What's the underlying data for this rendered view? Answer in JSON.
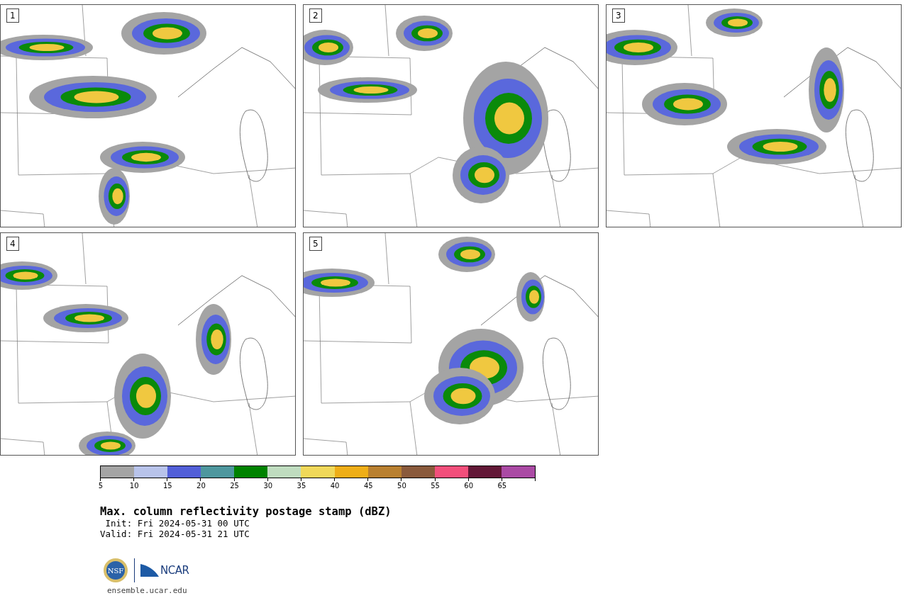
{
  "panels": [
    {
      "label": "1"
    },
    {
      "label": "2"
    },
    {
      "label": "3"
    },
    {
      "label": "4"
    },
    {
      "label": "5"
    }
  ],
  "colorbar": {
    "segments": [
      {
        "color": "#a4a4a4",
        "label": "5"
      },
      {
        "color": "#b8c3ea",
        "label": "10"
      },
      {
        "color": "#525fd8",
        "label": "15"
      },
      {
        "color": "#4e979e",
        "label": "20"
      },
      {
        "color": "#008200",
        "label": "25"
      },
      {
        "color": "#bfdcbf",
        "label": "30"
      },
      {
        "color": "#f0d85a",
        "label": "35"
      },
      {
        "color": "#eeae18",
        "label": "40"
      },
      {
        "color": "#b98030",
        "label": "45"
      },
      {
        "color": "#8a5a3c",
        "label": "50"
      },
      {
        "color": "#f24f7b",
        "label": "55"
      },
      {
        "color": "#621837",
        "label": "60"
      },
      {
        "color": "#aa4aa4",
        "label": "65"
      }
    ]
  },
  "title": "Max. column reflectivity postage stamp (dBZ)",
  "init": " Init: Fri 2024-05-31 00 UTC",
  "valid": "Valid: Fri 2024-05-31 21 UTC",
  "logos": {
    "nsf": "NSF",
    "ncar": "NCAR"
  },
  "site": "ensemble.ucar.edu"
}
